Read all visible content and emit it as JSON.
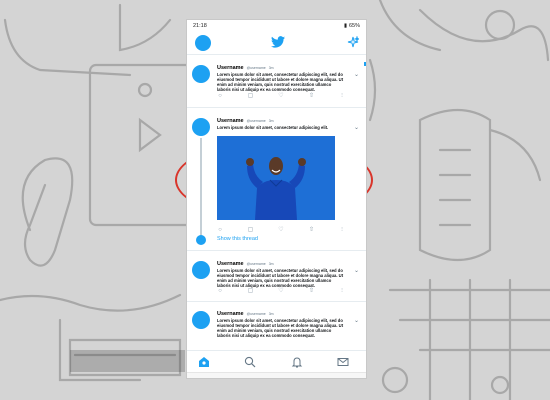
{
  "status_bar": {
    "time": "21:18",
    "battery": "65%"
  },
  "app_bar": {
    "home_icon": "twitter-bird-icon",
    "sparkle_icon": "sparkle-icon"
  },
  "tweets": [
    {
      "username": "Username",
      "handle": "@username",
      "time": "3m",
      "text": "Lorem ipsum dolor sit amet, consectetur adipiscing elit, sed do eiusmod tempor incididunt ut labore et dolore magna aliqua. Ut enim ad minim veniam, quis nostrud exercitation ullamco laboris nisi ut aliquip ex ea commodo consequat."
    },
    {
      "username": "Username",
      "handle": "@username",
      "time": "3m",
      "text": "Lorem ipsum dolor sit amet, consectetur adipiscing elit.",
      "thread_link": "Show this thread"
    },
    {
      "username": "Username",
      "handle": "@username",
      "time": "3m",
      "text": "Lorem ipsum dolor sit amet, consectetur adipiscing elit, sed do eiusmod tempor incididunt ut labore et dolore magna aliqua. Ut enim ad minim veniam, quis nostrud exercitation ullamco laboris nisi ut aliquip ex ea commodo consequat."
    },
    {
      "username": "Username",
      "handle": "@username",
      "time": "3m",
      "text": "Lorem ipsum dolor sit amet, consectetur adipiscing elit, sed do eiusmod tempor incididunt ut labore et dolore magna aliqua. Ut enim ad minim veniam, quis nostrud exercitation ullamco laboris nisi ut aliquip ex ea commodo consequat."
    }
  ],
  "tab_bar": [
    "home-icon",
    "search-icon",
    "notifications-icon",
    "messages-icon"
  ],
  "nav_bar": [
    "recent-apps-icon",
    "home-circle-icon",
    "back-icon"
  ],
  "colors": {
    "brand": "#1da1f2",
    "annotation": "#d9352b",
    "media_bg": "#1e6fd6"
  }
}
